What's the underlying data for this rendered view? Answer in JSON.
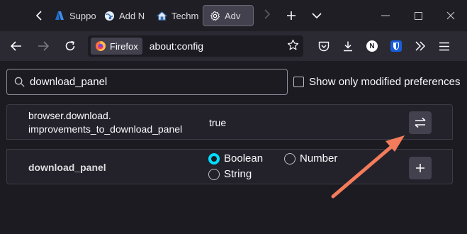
{
  "tabs": [
    {
      "label": "Suppo",
      "icon": "azure-a-icon"
    },
    {
      "label": "Add N",
      "icon": "globe-icon"
    },
    {
      "label": "Techm",
      "icon": "house-icon"
    },
    {
      "label": "Adv",
      "icon": "gear-icon",
      "active": true
    }
  ],
  "urlbar": {
    "identity_label": "Firefox",
    "url": "about:config"
  },
  "extensions": {
    "n_label": "N"
  },
  "search": {
    "value": "download_panel"
  },
  "filter": {
    "label": "Show only modified preferences",
    "checked": false
  },
  "preference": {
    "name_line1": "browser.download.",
    "name_line2": "improvements_to_download_panel",
    "value": "true"
  },
  "new_pref": {
    "name": "download_panel",
    "types": {
      "boolean": "Boolean",
      "number": "Number",
      "string": "String"
    },
    "selected": "Boolean"
  },
  "colors": {
    "accent": "#00ddff",
    "annotation_arrow": "#f47c5b",
    "background": "#1c1b22"
  }
}
